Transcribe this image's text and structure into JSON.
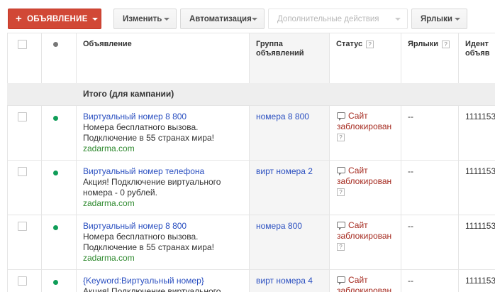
{
  "toolbar": {
    "new_ad_label": "ОБЪЯВЛЕНИЕ",
    "edit_label": "Изменить",
    "automation_label": "Автоматизация",
    "more_actions_label": "Дополнительные действия",
    "labels_label": "Ярлыки"
  },
  "columns": {
    "ad": "Объявление",
    "group_line1": "Группа",
    "group_line2": "объявлений",
    "status": "Статус",
    "labels": "Ярлыки",
    "id_line1": "Идент",
    "id_line2": "объяв"
  },
  "total_label": "Итого (для кампании)",
  "rows": [
    {
      "title": "Виртуальный номер 8 800",
      "desc1": "Номера бесплатного вызова.",
      "desc2": "Подключение в 55 странах мира!",
      "url": "zadarma.com",
      "group": "номера 8 800",
      "status1": "Сайт",
      "status2": "заблокирован",
      "labels": "--",
      "id": "1111153"
    },
    {
      "title": "Виртуальный номер телефона",
      "desc1": "Акция! Подключение виртуального",
      "desc2": "номера - 0 рублей.",
      "url": "zadarma.com",
      "group": "вирт номера 2",
      "status1": "Сайт",
      "status2": "заблокирован",
      "labels": "--",
      "id": "1111153"
    },
    {
      "title": "Виртуальный номер 8 800",
      "desc1": "Номера бесплатного вызова.",
      "desc2": "Подключение в 55 странах мира!",
      "url": "zadarma.com",
      "group": "номера 800",
      "status1": "Сайт",
      "status2": "заблокирован",
      "labels": "--",
      "id": "1111153"
    },
    {
      "title": "{Keyword:Виртуальный номер}",
      "desc1": "Акция! Подключение виртуального",
      "desc2": "",
      "url": "",
      "group": "вирт номера 4",
      "status1": "Сайт",
      "status2": "заблокирован",
      "labels": "--",
      "id": "1111153"
    }
  ],
  "help_glyph": "?",
  "colors": {
    "primary_button": "#d14836",
    "link": "#2a4fc0",
    "url": "#2f8a2f",
    "status_blocked": "#a52a1f",
    "enabled_dot": "#0f9d58"
  }
}
